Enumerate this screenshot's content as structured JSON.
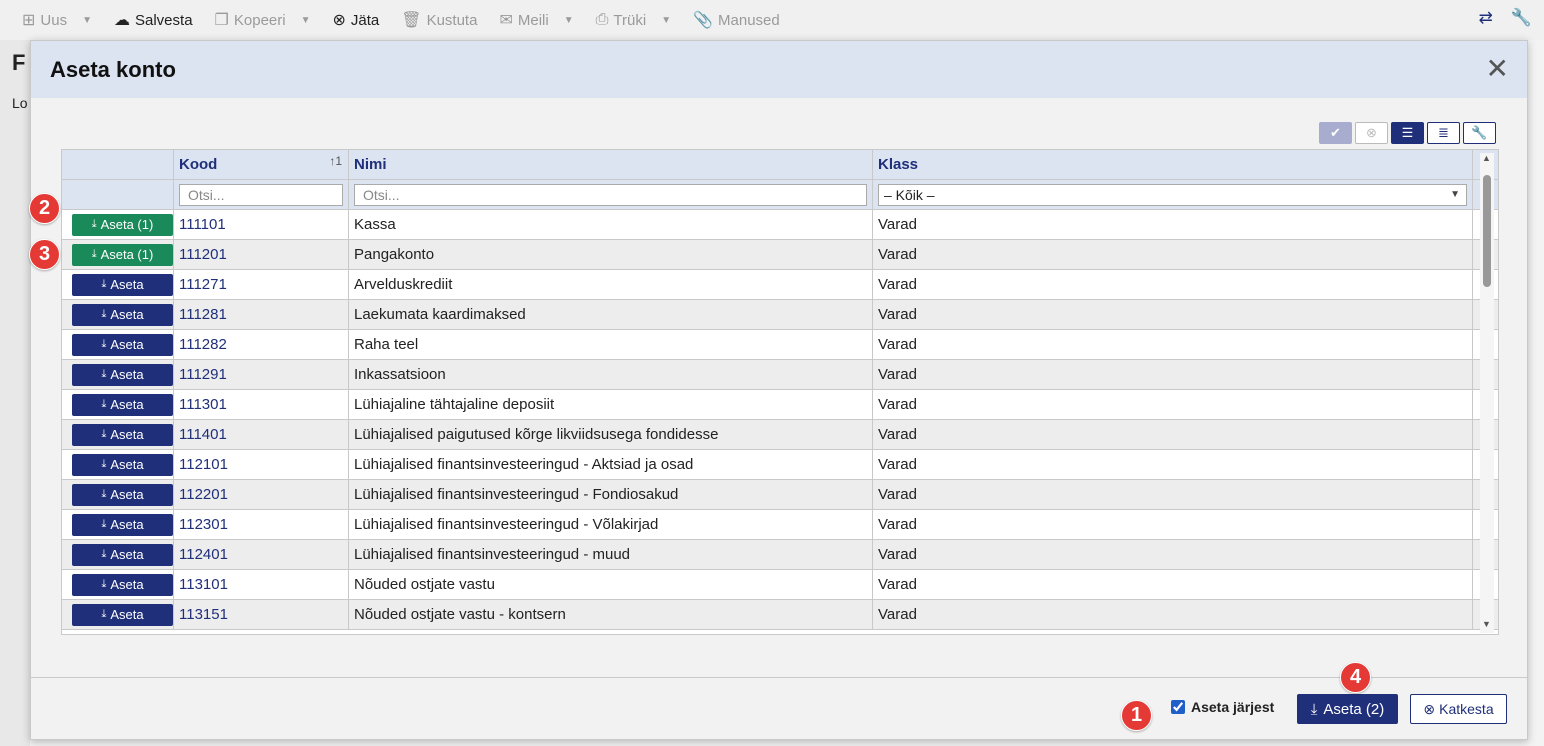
{
  "toolbar": {
    "items": [
      {
        "label": "Uus",
        "icon": "new-doc-icon",
        "glyph": "⊞",
        "disabled": true,
        "caret": true
      },
      {
        "label": "Salvesta",
        "icon": "cloud-upload-icon",
        "glyph": "☁",
        "disabled": false,
        "caret": false
      },
      {
        "label": "Kopeeri",
        "icon": "copy-icon",
        "glyph": "❐",
        "disabled": true,
        "caret": true
      },
      {
        "label": "Jäta",
        "icon": "cancel-circle-icon",
        "glyph": "⊗",
        "disabled": false,
        "caret": false
      },
      {
        "label": "Kustuta",
        "icon": "trash-icon",
        "glyph": "🗑",
        "disabled": true,
        "caret": false
      },
      {
        "label": "Meili",
        "icon": "mail-icon",
        "glyph": "✉",
        "disabled": true,
        "caret": true
      },
      {
        "label": "Trüki",
        "icon": "printer-icon",
        "glyph": "⎙",
        "disabled": true,
        "caret": true
      },
      {
        "label": "Manused",
        "icon": "paperclip-icon",
        "glyph": "📎",
        "disabled": true,
        "caret": false
      }
    ]
  },
  "background": {
    "page_title_letter": "F",
    "sub_letters": "Lo"
  },
  "dialog": {
    "title": "Aseta konto",
    "columns": {
      "kood": "Kood",
      "nimi": "Nimi",
      "klass": "Klass",
      "sort_indicator": "↑1"
    },
    "filters": {
      "kood_placeholder": "Otsi...",
      "nimi_placeholder": "Otsi...",
      "klass_selected": "– Kõik –"
    },
    "rows": [
      {
        "button": "Aseta (1)",
        "selected": true,
        "kood": "111101",
        "nimi": "Kassa",
        "klass": "Varad"
      },
      {
        "button": "Aseta (1)",
        "selected": true,
        "kood": "111201",
        "nimi": "Pangakonto",
        "klass": "Varad"
      },
      {
        "button": "Aseta",
        "selected": false,
        "kood": "111271",
        "nimi": "Arvelduskrediit",
        "klass": "Varad"
      },
      {
        "button": "Aseta",
        "selected": false,
        "kood": "111281",
        "nimi": "Laekumata kaardimaksed",
        "klass": "Varad"
      },
      {
        "button": "Aseta",
        "selected": false,
        "kood": "111282",
        "nimi": "Raha teel",
        "klass": "Varad"
      },
      {
        "button": "Aseta",
        "selected": false,
        "kood": "111291",
        "nimi": "Inkassatsioon",
        "klass": "Varad"
      },
      {
        "button": "Aseta",
        "selected": false,
        "kood": "111301",
        "nimi": "Lühiajaline tähtajaline deposiit",
        "klass": "Varad"
      },
      {
        "button": "Aseta",
        "selected": false,
        "kood": "111401",
        "nimi": "Lühiajalised paigutused kõrge likviidsusega fondidesse",
        "klass": "Varad"
      },
      {
        "button": "Aseta",
        "selected": false,
        "kood": "112101",
        "nimi": "Lühiajalised finantsinvesteeringud - Aktsiad ja osad",
        "klass": "Varad"
      },
      {
        "button": "Aseta",
        "selected": false,
        "kood": "112201",
        "nimi": "Lühiajalised finantsinvesteeringud - Fondiosakud",
        "klass": "Varad"
      },
      {
        "button": "Aseta",
        "selected": false,
        "kood": "112301",
        "nimi": "Lühiajalised finantsinvesteeringud - Võlakirjad",
        "klass": "Varad"
      },
      {
        "button": "Aseta",
        "selected": false,
        "kood": "112401",
        "nimi": "Lühiajalised finantsinvesteeringud - muud",
        "klass": "Varad"
      },
      {
        "button": "Aseta",
        "selected": false,
        "kood": "113101",
        "nimi": "Nõuded ostjate vastu",
        "klass": "Varad"
      },
      {
        "button": "Aseta",
        "selected": false,
        "kood": "113151",
        "nimi": "Nõuded ostjate vastu - kontsern",
        "klass": "Varad"
      }
    ],
    "footer": {
      "checkbox_label": "Aseta järjest",
      "checkbox_checked": true,
      "main_button": "Aseta (2)",
      "cancel_button": "Katkesta"
    }
  },
  "badges": [
    "1",
    "2",
    "3",
    "4"
  ],
  "colors": {
    "primary": "#1f2f7a",
    "selected_green": "#1a8a5a",
    "header_bg": "#dce3f1",
    "badge_red": "#e53935"
  }
}
